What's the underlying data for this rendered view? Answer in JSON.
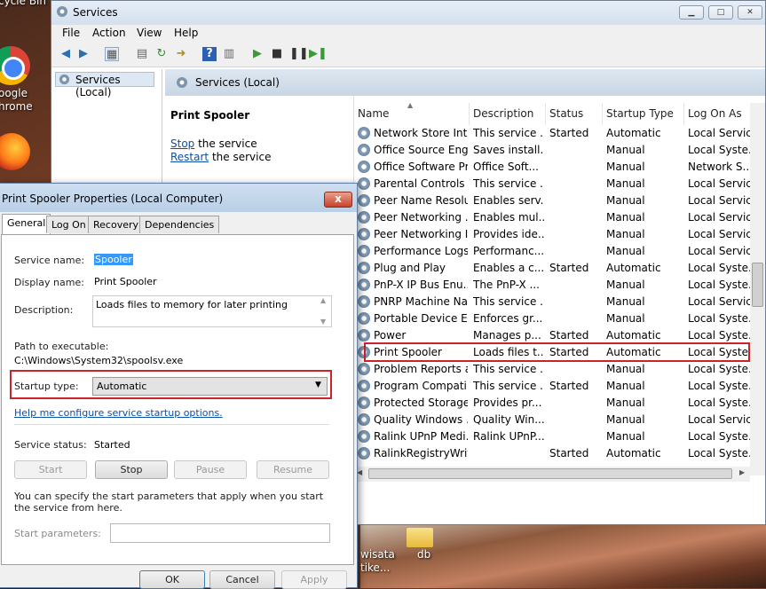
{
  "desktop": {
    "recycle_label": "cycle Bin",
    "chrome_label_1": "oogle",
    "chrome_label_2": "hrome",
    "wisata_label_1": "wisata",
    "wisata_label_2": "tike...",
    "db_label": "db"
  },
  "services_window": {
    "title": "Services",
    "menu": [
      "File",
      "Action",
      "View",
      "Help"
    ],
    "tree_item": "Services (Local)",
    "header": "Services (Local)",
    "selected_service_name": "Print Spooler",
    "stop_link": "Stop",
    "stop_suffix": " the service",
    "restart_link": "Restart",
    "restart_suffix": " the service",
    "columns": [
      "Name",
      "Description",
      "Status",
      "Startup Type",
      "Log On As"
    ],
    "rows": [
      {
        "name": "Network Store Int...",
        "desc": "This service ...",
        "status": "Started",
        "startup": "Automatic",
        "logon": "Local Service"
      },
      {
        "name": "Office  Source Eng...",
        "desc": "Saves install...",
        "status": "",
        "startup": "Manual",
        "logon": "Local Syste..."
      },
      {
        "name": "Office Software Pr...",
        "desc": "Office Soft...",
        "status": "",
        "startup": "Manual",
        "logon": "Network S..."
      },
      {
        "name": "Parental Controls",
        "desc": "This service ...",
        "status": "",
        "startup": "Manual",
        "logon": "Local Service"
      },
      {
        "name": "Peer Name Resolu...",
        "desc": "Enables serv...",
        "status": "",
        "startup": "Manual",
        "logon": "Local Service"
      },
      {
        "name": "Peer Networking ...",
        "desc": "Enables mul...",
        "status": "",
        "startup": "Manual",
        "logon": "Local Service"
      },
      {
        "name": "Peer Networking I...",
        "desc": "Provides ide...",
        "status": "",
        "startup": "Manual",
        "logon": "Local Service"
      },
      {
        "name": "Performance Logs...",
        "desc": "Performanc...",
        "status": "",
        "startup": "Manual",
        "logon": "Local Service"
      },
      {
        "name": "Plug and Play",
        "desc": "Enables a c...",
        "status": "Started",
        "startup": "Automatic",
        "logon": "Local Syste..."
      },
      {
        "name": "PnP-X IP Bus Enu...",
        "desc": "The PnP-X ...",
        "status": "",
        "startup": "Manual",
        "logon": "Local Syste..."
      },
      {
        "name": "PNRP Machine Na...",
        "desc": "This service ...",
        "status": "",
        "startup": "Manual",
        "logon": "Local Service"
      },
      {
        "name": "Portable Device E...",
        "desc": "Enforces gr...",
        "status": "",
        "startup": "Manual",
        "logon": "Local Syste..."
      },
      {
        "name": "Power",
        "desc": "Manages p...",
        "status": "Started",
        "startup": "Automatic",
        "logon": "Local Syste..."
      },
      {
        "name": "Print Spooler",
        "desc": "Loads files t...",
        "status": "Started",
        "startup": "Automatic",
        "logon": "Local Syste..."
      },
      {
        "name": "Problem Reports a...",
        "desc": "This service ...",
        "status": "",
        "startup": "Manual",
        "logon": "Local Syste..."
      },
      {
        "name": "Program Compati...",
        "desc": "This service ...",
        "status": "Started",
        "startup": "Manual",
        "logon": "Local Syste..."
      },
      {
        "name": "Protected Storage",
        "desc": "Provides pr...",
        "status": "",
        "startup": "Manual",
        "logon": "Local Syste..."
      },
      {
        "name": "Quality Windows ...",
        "desc": "Quality Win...",
        "status": "",
        "startup": "Manual",
        "logon": "Local Service"
      },
      {
        "name": "Ralink UPnP Medi...",
        "desc": "Ralink UPnP...",
        "status": "",
        "startup": "Manual",
        "logon": "Local Syste..."
      },
      {
        "name": "RalinkRegistryWriter",
        "desc": "",
        "status": "Started",
        "startup": "Automatic",
        "logon": "Local Syste..."
      }
    ]
  },
  "properties_dialog": {
    "title": "Print Spooler Properties (Local Computer)",
    "close_glyph": "x",
    "tabs": [
      "General",
      "Log On",
      "Recovery",
      "Dependencies"
    ],
    "service_name_label": "Service name:",
    "service_name_value": "Spooler",
    "display_name_label": "Display name:",
    "display_name_value": "Print Spooler",
    "description_label": "Description:",
    "description_value": "Loads files to memory for later printing",
    "path_label": "Path to executable:",
    "path_value": "C:\\Windows\\System32\\spoolsv.exe",
    "startup_type_label": "Startup type:",
    "startup_type_value": "Automatic",
    "help_link": "Help me configure service startup options.",
    "service_status_label": "Service status:",
    "service_status_value": "Started",
    "start_button": "Start",
    "stop_button": "Stop",
    "pause_button": "Pause",
    "resume_button": "Resume",
    "hint": "You can specify the start parameters that apply when you start the service from here.",
    "start_params_label": "Start parameters:",
    "start_params_value": "",
    "ok_button": "OK",
    "cancel_button": "Cancel",
    "apply_button": "Apply"
  }
}
